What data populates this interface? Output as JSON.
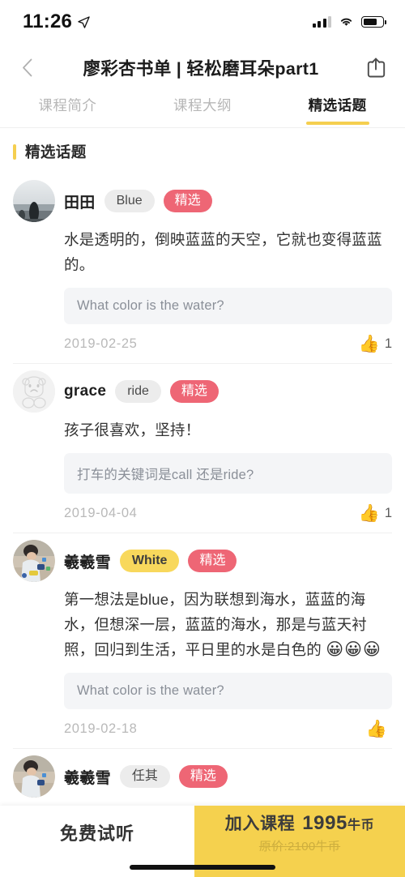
{
  "status_bar": {
    "time": "11:26",
    "location_icon": "location-arrow-icon",
    "signal_icon": "cellular-signal-icon",
    "wifi_icon": "wifi-icon",
    "battery_icon": "battery-icon",
    "battery_level": "70%"
  },
  "nav": {
    "back_icon": "chevron-left-icon",
    "title": "廖彩杏书单 | 轻松磨耳朵part1",
    "share_icon": "share-icon"
  },
  "tabs": [
    {
      "label": "课程简介",
      "active": false
    },
    {
      "label": "课程大纲",
      "active": false
    },
    {
      "label": "精选话题",
      "active": true
    }
  ],
  "section": {
    "title": "精选话题",
    "accent_color": "#f5cf4f"
  },
  "comments": [
    {
      "avatar_name": "avatar-landscape-photo",
      "user": "田田",
      "tag": "Blue",
      "tag_style": "gray",
      "badge": "精选",
      "text": "水是透明的，倒映蓝蓝的天空，它就也变得蓝蓝的。",
      "emoji": "",
      "quote": "What color is the water?",
      "date": "2019-02-25",
      "like_icon": "thumbs-up-icon",
      "likes": "1"
    },
    {
      "avatar_name": "avatar-cartoon-bear",
      "user": "grace",
      "tag": "ride",
      "tag_style": "gray",
      "badge": "精选",
      "text": "孩子很喜欢，坚持！",
      "emoji": "",
      "quote": "打车的关键词是call 还是ride?",
      "date": "2019-04-04",
      "like_icon": "thumbs-up-icon",
      "likes": "1"
    },
    {
      "avatar_name": "avatar-child-photo",
      "user": "羲羲雪",
      "tag": "White",
      "tag_style": "yellow",
      "badge": "精选",
      "text": "第一想法是blue，因为联想到海水，蓝蓝的海水，但想深一层，蓝蓝的海水，那是与蓝天衬照，回归到生活，平日里的水是白色的",
      "emoji": "😀😀😀",
      "quote": "What color is the water?",
      "date": "2019-02-18",
      "like_icon": "thumbs-up-icon",
      "likes": ""
    },
    {
      "avatar_name": "avatar-child-photo",
      "user": "羲羲雪",
      "tag": "任其",
      "tag_style": "gray",
      "badge": "精选",
      "text": "",
      "emoji": "",
      "quote": "",
      "date": "",
      "like_icon": "thumbs-up-icon",
      "likes": ""
    }
  ],
  "bottom_bar": {
    "trial_label": "免费试听",
    "cta_label": "加入课程",
    "cta_price": "1995",
    "cta_unit": "牛币",
    "cta_original_price": "原价:2100牛币",
    "cta_color": "#f5d14e"
  }
}
